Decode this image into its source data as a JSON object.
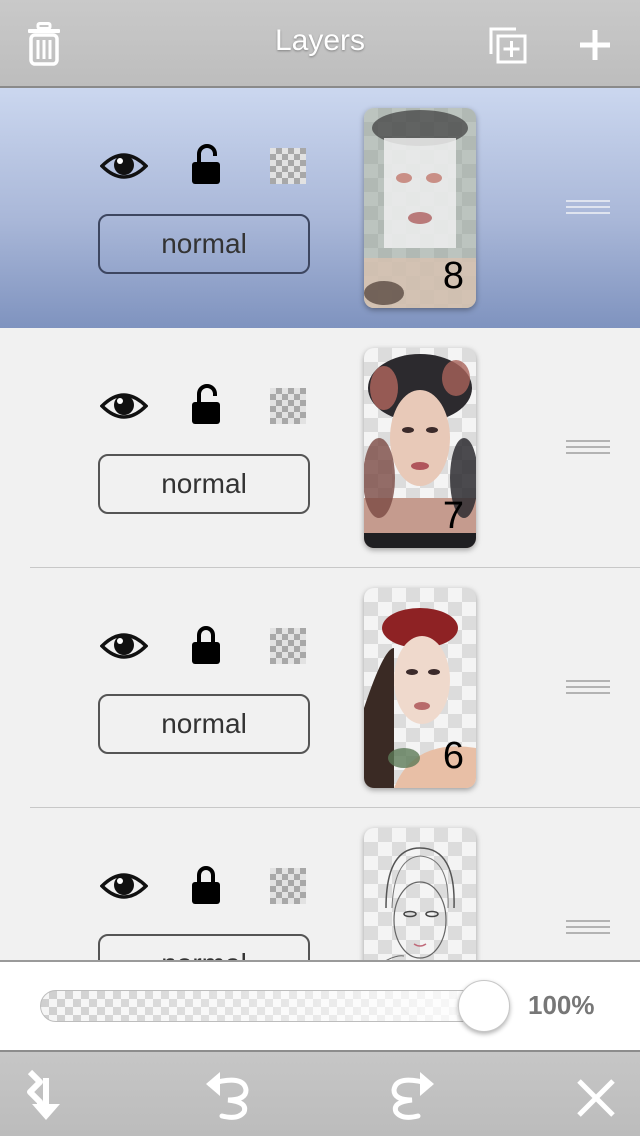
{
  "header": {
    "title": "Layers",
    "left_icon": "trash-icon",
    "right_icons": [
      "duplicate-layer-icon",
      "add-layer-icon"
    ]
  },
  "layers": [
    {
      "number": "8",
      "blend_mode": "normal",
      "visible": true,
      "locked": false,
      "selected": true
    },
    {
      "number": "7",
      "blend_mode": "normal",
      "visible": true,
      "locked": false,
      "selected": false
    },
    {
      "number": "6",
      "blend_mode": "normal",
      "visible": true,
      "locked": true,
      "selected": false
    },
    {
      "number": "",
      "blend_mode": "normal",
      "visible": true,
      "locked": true,
      "selected": false
    }
  ],
  "opacity": {
    "label": "100%",
    "value": 1.0
  },
  "toolbar": {
    "icons": [
      "merge-down-icon",
      "undo-icon",
      "redo-icon",
      "close-icon"
    ]
  },
  "colors": {
    "selected_row": "#a9b7d8",
    "bar": "#c4c4c4",
    "row": "#f1f1f1"
  }
}
